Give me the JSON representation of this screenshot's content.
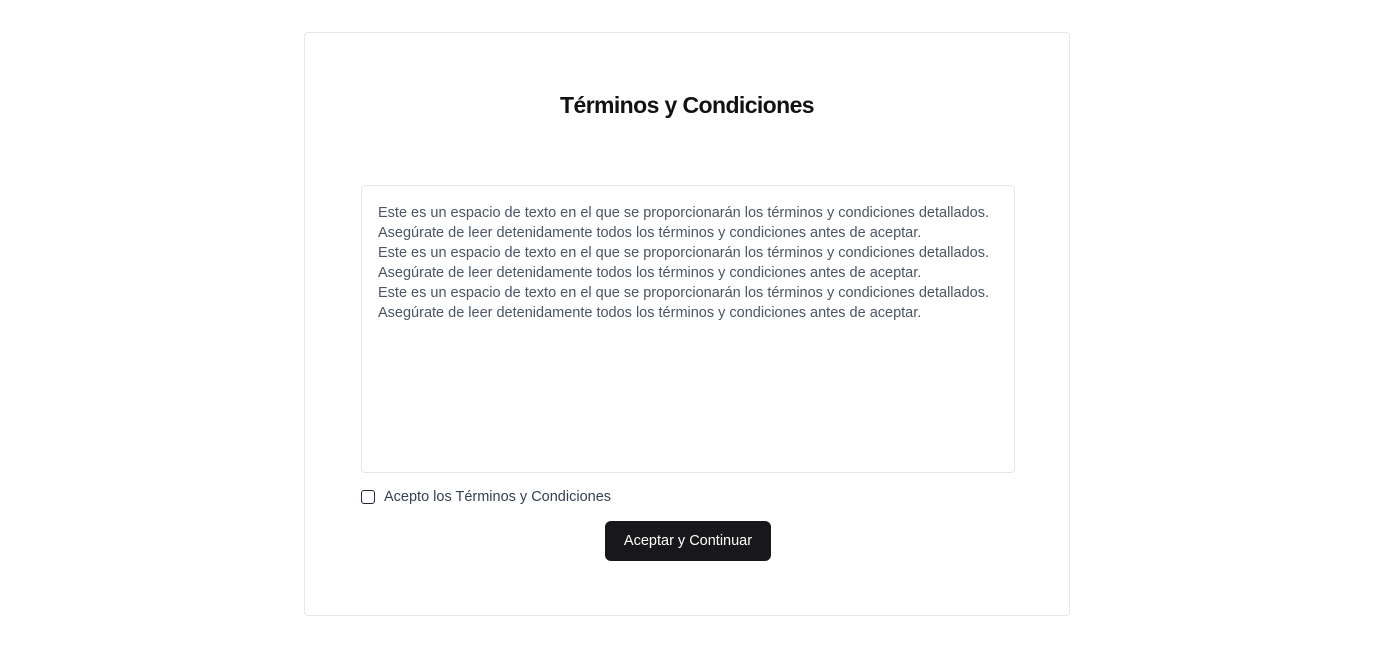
{
  "card": {
    "title": "Términos y Condiciones"
  },
  "terms": {
    "paragraphs": [
      "Este es un espacio de texto en el que se proporcionarán los términos y condiciones detallados. Asegúrate de leer detenidamente todos los términos y condiciones antes de aceptar.",
      "Este es un espacio de texto en el que se proporcionarán los términos y condiciones detallados. Asegúrate de leer detenidamente todos los términos y condiciones antes de aceptar.",
      "Este es un espacio de texto en el que se proporcionarán los términos y condiciones detallados. Asegúrate de leer detenidamente todos los términos y condiciones antes de aceptar."
    ]
  },
  "accept": {
    "label": "Acepto los Términos y Condiciones",
    "checked": false
  },
  "button": {
    "label": "Aceptar y Continuar"
  },
  "colors": {
    "button_bg": "#18181b",
    "border": "#e5e7eb",
    "body_text": "#4b5563"
  }
}
